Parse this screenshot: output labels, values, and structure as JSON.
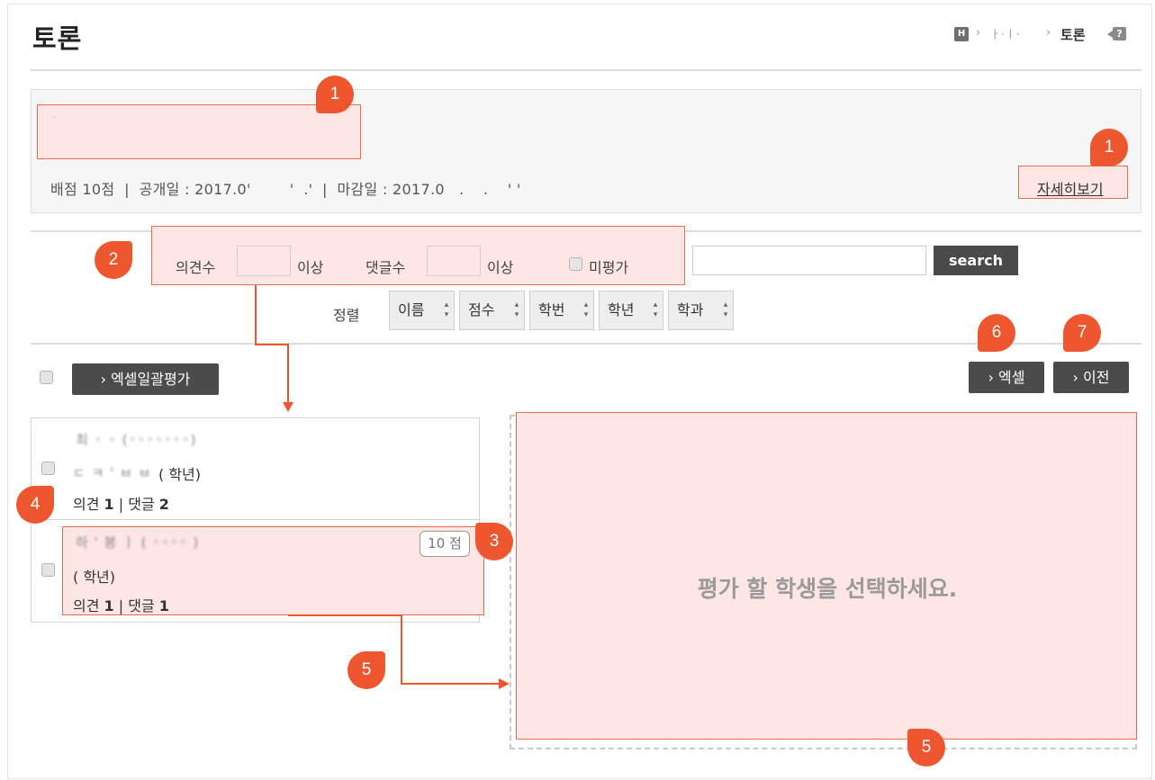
{
  "header": {
    "title": "토론",
    "breadcrumb": {
      "home_icon": "H",
      "separator": "›",
      "middle": "ㅏ·ㅣ·",
      "current": "토론",
      "help_icon": "?"
    }
  },
  "info": {
    "title_dot": "·",
    "meta": "배점 10점  |  공개일 : 2017.0'        '  .'  |  마감일 : 2017.0   .    .    ' '",
    "detail_link": "자세히보기"
  },
  "filter": {
    "opinions_label": "의견수",
    "opinions_value": "",
    "opinions_suffix": "이상",
    "comments_label": "댓글수",
    "comments_value": "",
    "comments_suffix": "이상",
    "unevaluated_label": "미평가",
    "search_value": "",
    "search_button": "search"
  },
  "sort": {
    "label": "정렬",
    "buttons": [
      "이름",
      "점수",
      "학번",
      "학년",
      "학과"
    ],
    "direction_icon": "sort-updown-icon"
  },
  "toolbar": {
    "excel_batch_button": "› 엑셀일괄평가",
    "excel_button": "› 엑셀",
    "prev_button": "› 이전"
  },
  "students": [
    {
      "name_blurred": "최 ◦ ◦ (◦◦◦◦◦◦◦)",
      "dept_blurred": "ㄷ ㅋ ' ㅂ ㅂ",
      "grade": "( 학년)",
      "opinion_label": "의견",
      "opinion_count": "1",
      "comment_label": "댓글",
      "comment_count": "2",
      "score": ""
    },
    {
      "name_blurred": "하 ' 봉 ㅣ ( ◦◦◦◦ )",
      "dept_blurred": "",
      "grade": "( 학년)",
      "opinion_label": "의견",
      "opinion_count": "1",
      "comment_label": "댓글",
      "comment_count": "1",
      "score": "10 점"
    }
  ],
  "eval_panel": {
    "message": "평가 할 학생을 선택하세요."
  },
  "markers": [
    "1",
    "1",
    "2",
    "3",
    "4",
    "5",
    "5",
    "6",
    "7"
  ],
  "colors": {
    "marker": "#ee5630",
    "highlight_fill": "#fde6e4",
    "highlight_border": "#f06a4f",
    "dark_button": "#4b4b4b"
  }
}
